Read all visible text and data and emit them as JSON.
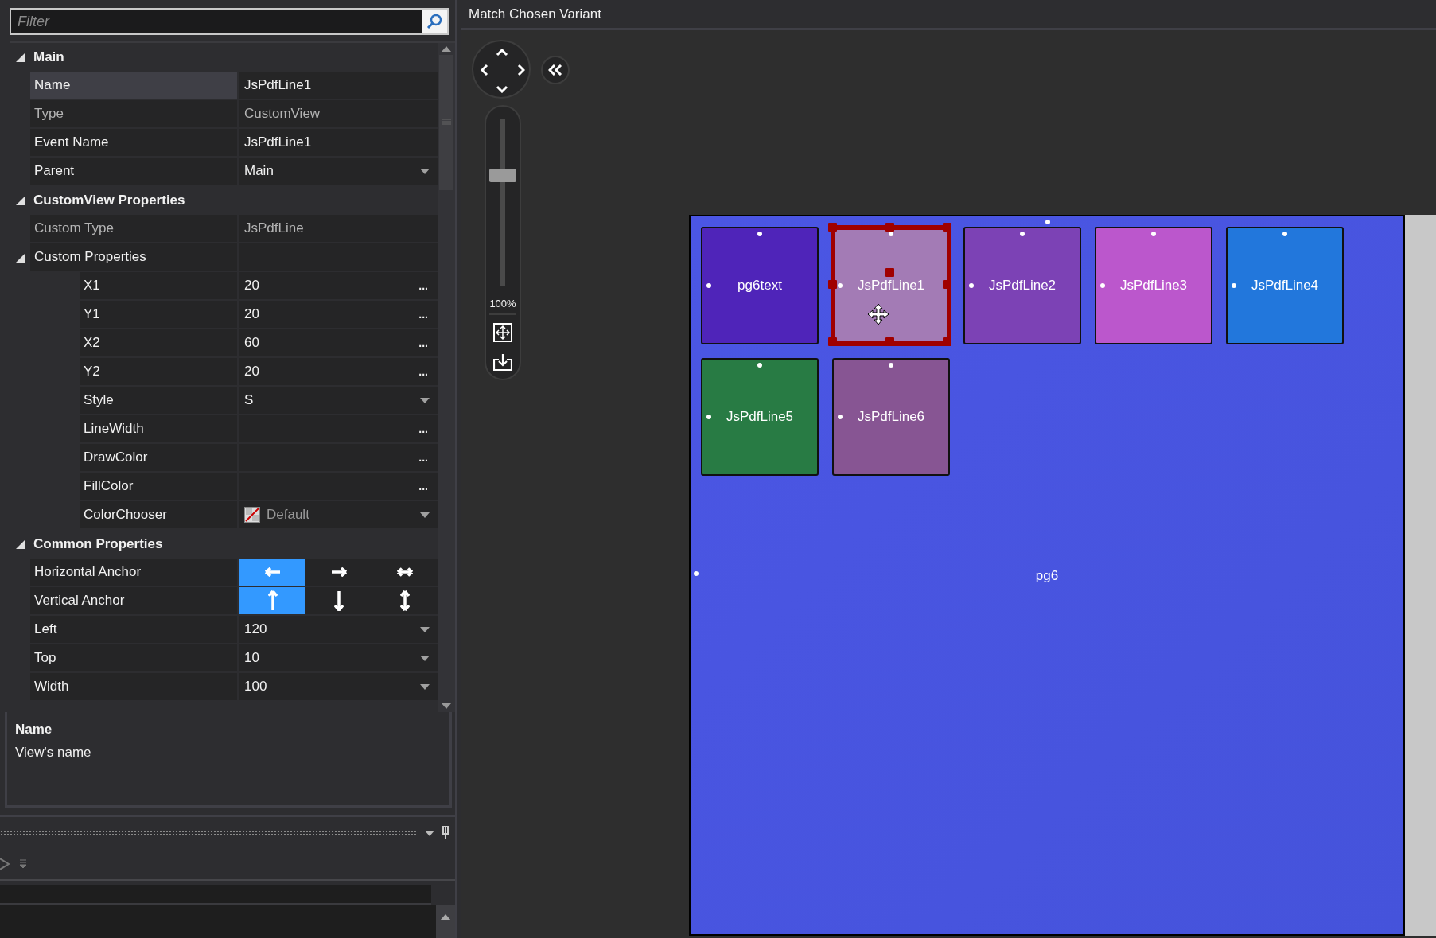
{
  "filter": {
    "placeholder": "Filter"
  },
  "property_grid": {
    "sections": [
      {
        "title": "Main",
        "expanded": true,
        "rows": [
          {
            "label": "Name",
            "value": "JsPdfLine1",
            "kind": "text",
            "selected": true,
            "disabled": false
          },
          {
            "label": "Type",
            "value": "CustomView",
            "kind": "text",
            "selected": false,
            "disabled": true
          },
          {
            "label": "Event Name",
            "value": "JsPdfLine1",
            "kind": "text",
            "selected": false,
            "disabled": false
          },
          {
            "label": "Parent",
            "value": "Main",
            "kind": "dropdown",
            "selected": false,
            "disabled": false
          }
        ]
      },
      {
        "title": "CustomView Properties",
        "expanded": true,
        "rows": [
          {
            "label": "Custom Type",
            "value": "JsPdfLine",
            "kind": "text",
            "selected": false,
            "disabled": true
          },
          {
            "label": "Custom Properties",
            "kind": "group",
            "expanded": true,
            "selected": false,
            "disabled": false,
            "children": [
              {
                "label": "X1",
                "value": "20",
                "kind": "ellipsis",
                "action": "...",
                "selected": false,
                "disabled": false
              },
              {
                "label": "Y1",
                "value": "20",
                "kind": "ellipsis",
                "action": "...",
                "selected": false,
                "disabled": false
              },
              {
                "label": "X2",
                "value": "60",
                "kind": "ellipsis",
                "action": "...",
                "selected": false,
                "disabled": false
              },
              {
                "label": "Y2",
                "value": "20",
                "kind": "ellipsis",
                "action": "...",
                "selected": false,
                "disabled": false
              },
              {
                "label": "Style",
                "value": "S",
                "kind": "dropdown",
                "selected": false,
                "disabled": false
              },
              {
                "label": "LineWidth",
                "kind": "ellipsis",
                "action": "...",
                "selected": false,
                "disabled": false
              },
              {
                "label": "DrawColor",
                "kind": "ellipsis",
                "action": "...",
                "selected": false,
                "disabled": false
              },
              {
                "label": "FillColor",
                "kind": "ellipsis",
                "action": "...",
                "selected": false,
                "disabled": false
              },
              {
                "label": "ColorChooser",
                "value": "Default",
                "kind": "color",
                "selected": false,
                "disabled": false
              }
            ]
          }
        ]
      },
      {
        "title": "Common Properties",
        "expanded": true,
        "rows": [
          {
            "label": "Horizontal Anchor",
            "kind": "anchor",
            "selected": false,
            "disabled": false,
            "options": [
              {
                "kind": "left",
                "selected": true
              },
              {
                "kind": "right",
                "selected": false
              },
              {
                "kind": "both_h",
                "selected": false
              }
            ]
          },
          {
            "label": "Vertical Anchor",
            "kind": "anchor",
            "selected": false,
            "disabled": false,
            "options": [
              {
                "kind": "up",
                "selected": true
              },
              {
                "kind": "down",
                "selected": false
              },
              {
                "kind": "both_v",
                "selected": false
              }
            ]
          },
          {
            "label": "Left",
            "value": "120",
            "kind": "dropdown",
            "selected": false,
            "disabled": false
          },
          {
            "label": "Top",
            "value": "10",
            "kind": "dropdown",
            "selected": false,
            "disabled": false
          },
          {
            "label": "Width",
            "value": "100",
            "kind": "dropdown",
            "selected": false,
            "disabled": false
          }
        ]
      }
    ]
  },
  "description": {
    "title": "Name",
    "text": "View's name"
  },
  "designer": {
    "title": "Match Chosen Variant",
    "zoom": {
      "level": 0.68,
      "reading": "100%"
    },
    "canvas": {
      "name": "pg6",
      "items": [
        {
          "label": "pg6text",
          "color": "#4f24b9",
          "selected": false
        },
        {
          "label": "JsPdfLine1",
          "color": "#a37bb5",
          "selected": true
        },
        {
          "label": "JsPdfLine2",
          "color": "#7c42b5",
          "selected": false
        },
        {
          "label": "JsPdfLine3",
          "color": "#bb57cc",
          "selected": false
        },
        {
          "label": "JsPdfLine4",
          "color": "#2277dc",
          "selected": false
        },
        {
          "label": "JsPdfLine5",
          "color": "#287b44",
          "selected": false
        },
        {
          "label": "JsPdfLine6",
          "color": "#875593",
          "selected": false
        }
      ]
    }
  }
}
